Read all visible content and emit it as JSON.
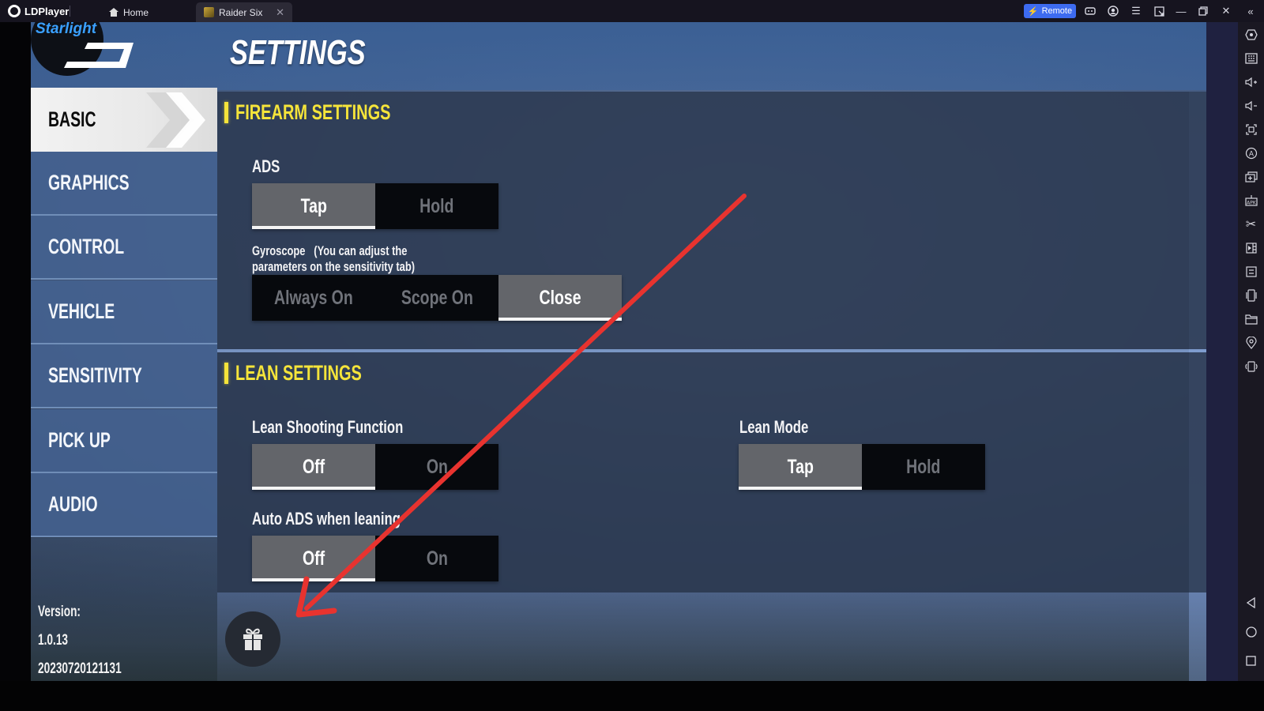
{
  "titlebar": {
    "app_name": "LDPlayer",
    "tabs": [
      {
        "label": "Home",
        "icon": "home-icon"
      },
      {
        "label": "Raider Six",
        "icon": "game-icon",
        "active": true
      }
    ],
    "remote_label": "Remote",
    "remote_color": "#3d6bf0",
    "controls": [
      "gamepad-icon",
      "account-icon",
      "menu-icon",
      "resize-icon",
      "minimize-icon",
      "restore-icon",
      "close-icon",
      "collapse-sidebar-icon"
    ]
  },
  "game": {
    "logo_text": "Starlight",
    "title": "SETTINGS",
    "menu": [
      {
        "label": "BASIC",
        "active": true
      },
      {
        "label": "GRAPHICS"
      },
      {
        "label": "CONTROL"
      },
      {
        "label": "VEHICLE"
      },
      {
        "label": "SENSITIVITY"
      },
      {
        "label": "PICK UP"
      },
      {
        "label": "AUDIO"
      }
    ],
    "version": {
      "label": "Version:",
      "number": "1.0.13",
      "build": "20230720121131"
    },
    "firearm": {
      "title": "FIREARM SETTINGS",
      "ads": {
        "label": "ADS",
        "options": [
          "Tap",
          "Hold"
        ],
        "selected": "Tap"
      },
      "gyroscope": {
        "label_line1": "Gyroscope   (You can adjust the",
        "label_line2": "parameters on the sensitivity tab)",
        "options": [
          "Always On",
          "Scope On",
          "Close"
        ],
        "selected": "Close"
      }
    },
    "lean": {
      "title": "LEAN SETTINGS",
      "lean_shooting": {
        "label": "Lean Shooting Function",
        "options": [
          "Off",
          "On"
        ],
        "selected": "Off"
      },
      "auto_ads": {
        "label": "Auto ADS when leaning",
        "options": [
          "Off",
          "On"
        ],
        "selected": "Off"
      },
      "lean_mode": {
        "label": "Lean Mode",
        "options": [
          "Tap",
          "Hold"
        ],
        "selected": "Tap"
      }
    },
    "accent_color": "#f5e43a",
    "annotation_arrow_color": "#e8332f"
  },
  "sidebar": {
    "icons": [
      "settings-hex-icon",
      "keyboard-icon",
      "volume-up-icon",
      "volume-down-icon",
      "screenshot-icon",
      "auto-rotate-icon",
      "multi-instance-icon",
      "apk-install-icon",
      "scissors-icon",
      "video-record-icon",
      "sync-icon",
      "shake-icon",
      "folder-icon",
      "location-icon",
      "rotate-device-icon"
    ],
    "nav": [
      "back-icon",
      "home-circle-icon",
      "recents-icon"
    ]
  }
}
